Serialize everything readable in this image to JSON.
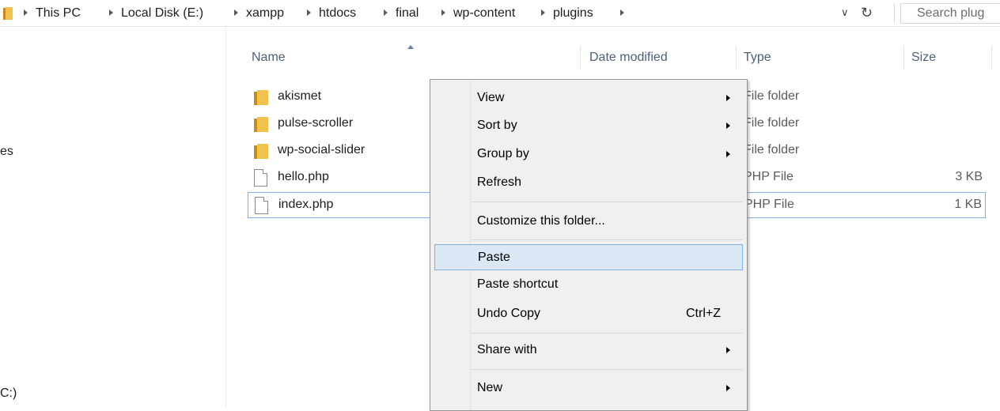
{
  "address_bar": {
    "breadcrumbs": [
      "This PC",
      "Local Disk (E:)",
      "xampp",
      "htdocs",
      "final",
      "wp-content",
      "plugins"
    ],
    "search_placeholder": "Search plug"
  },
  "nav_pane": {
    "partial_items": [
      "es",
      "C:)"
    ]
  },
  "columns": {
    "name": "Name",
    "date": "Date modified",
    "type": "Type",
    "size": "Size"
  },
  "files": [
    {
      "name": "akismet",
      "type": "File folder",
      "size": "",
      "icon": "folder-icon"
    },
    {
      "name": "pulse-scroller",
      "type": "File folder",
      "size": "",
      "icon": "folder-icon"
    },
    {
      "name": "wp-social-slider",
      "type": "File folder",
      "size": "",
      "icon": "folder-icon"
    },
    {
      "name": "hello.php",
      "type": "PHP File",
      "size": "3 KB",
      "icon": "file-icon"
    },
    {
      "name": "index.php",
      "type": "PHP File",
      "size": "1 KB",
      "icon": "file-icon"
    }
  ],
  "context_menu": {
    "view": "View",
    "sort_by": "Sort by",
    "group_by": "Group by",
    "refresh": "Refresh",
    "customize": "Customize this folder...",
    "paste": "Paste",
    "paste_shortcut": "Paste shortcut",
    "undo_copy": "Undo Copy",
    "undo_copy_shortcut": "Ctrl+Z",
    "share_with": "Share with",
    "new": "New"
  },
  "colors": {
    "selection_border": "#7fb1e6",
    "menu_hover": "#dbe8f6",
    "header_text": "#4c607a"
  }
}
